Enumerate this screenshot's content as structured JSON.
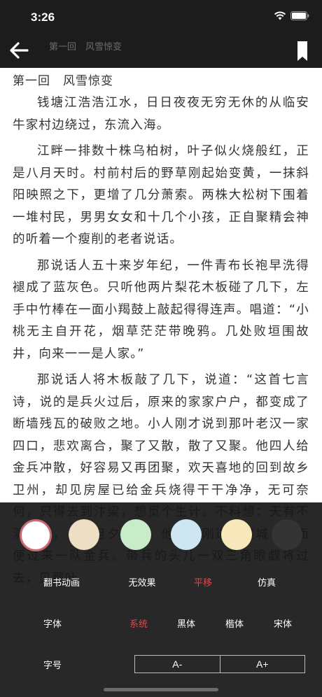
{
  "status": {
    "time": "3:26"
  },
  "header": {
    "title": "第一回　风雪惊变"
  },
  "chapter": {
    "title": "第一回　风雪惊变"
  },
  "content": {
    "paragraphs": [
      "钱塘江浩浩江水，日日夜夜无穷无休的从临安牛家村边绕过，东流入海。",
      "江畔一排数十株乌柏树，叶子似火烧般红，正是八月天时。村前村后的野草刚起始变黄，一抹斜阳映照之下，更增了几分萧索。两株大松树下围着一堆村民，男男女女和十几个小孩，正自聚精会神的听着一个瘦削的老者说话。",
      "那说话人五十来岁年纪，一件青布长袍早洗得褪成了蓝灰色。只听他两片梨花木板碰了几下，左手中竹棒在一面小羯鼓上敲起得得连声。唱道：“小桃无主自开花，烟草茫茫带晚鸦。几处败垣围故井，向来一一是人家。”",
      "那说话人将木板敲了几下，说道：“这首七言诗，说的是兵火过后，原来的家家户户，都变成了断墙残瓦的破败之地。小人刚才说到那叶老汉一家四口，悲欢离合，聚了又散，散了又聚。他四人给金兵冲散，好容易又再团聚，欢天喜地的回到故乡卫州，却见房屋已给金兵烧得干干净净，无可奈何，只得去到汴梁，想觅个生计。不料想：天有不测风云，人有旦夕祸福。他四人刚进汴梁城，迎面便过来一队金兵。带兵的头儿一双三角眼觑将过去，见那叶"
    ]
  },
  "settings": {
    "swatches": [
      {
        "color": "#ffffff",
        "selected": true
      },
      {
        "color": "#ecdfc3"
      },
      {
        "color": "#c8ecc8"
      },
      {
        "color": "#cde6f1"
      },
      {
        "color": "#f8e7bb"
      },
      {
        "color": "#343434"
      }
    ],
    "page_turn": {
      "label": "翻书动画",
      "options": [
        "无效果",
        "平移",
        "仿真"
      ],
      "selected": "平移"
    },
    "font": {
      "label": "字体",
      "options": [
        "系统",
        "黑体",
        "楷体",
        "宋体"
      ],
      "selected": "系统"
    },
    "font_size": {
      "label": "字号",
      "decrease": "A-",
      "increase": "A+"
    },
    "accent_color": "#e0464b"
  }
}
